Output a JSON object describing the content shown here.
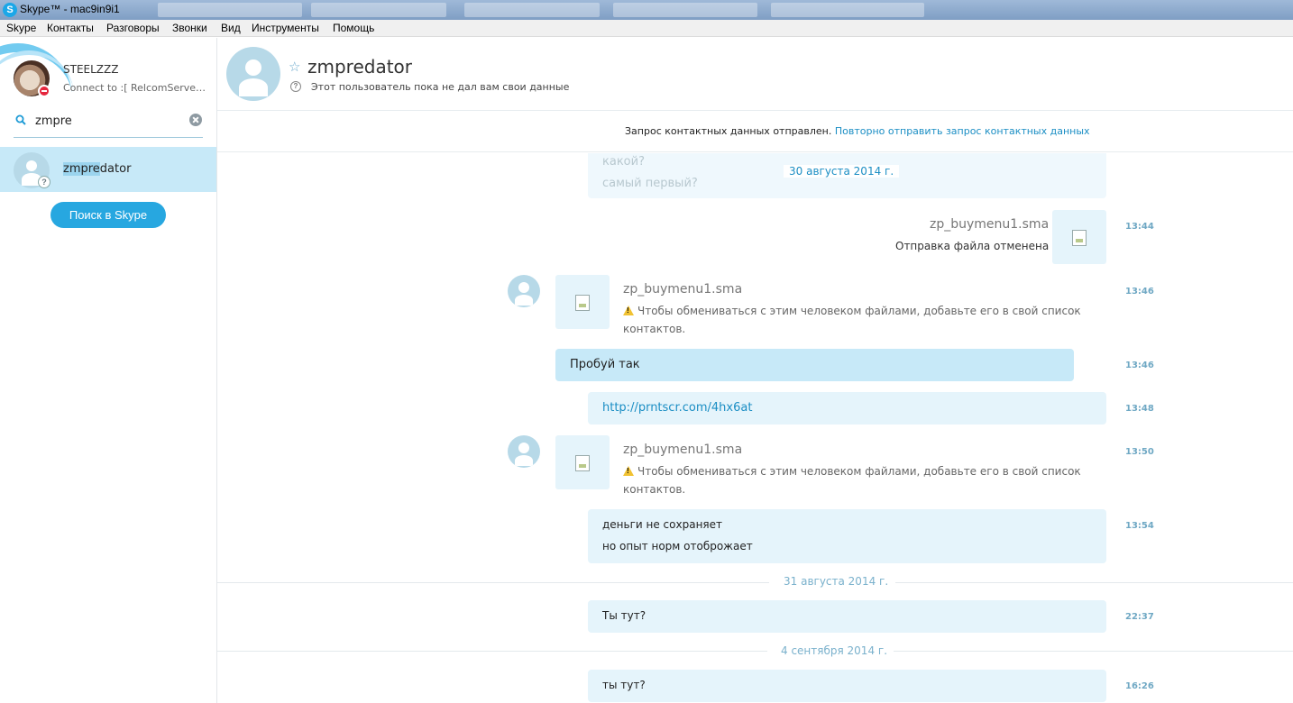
{
  "window": {
    "title": "Skype™ - mac9in9i1"
  },
  "menu": [
    "Skype",
    "Контакты",
    "Разговоры",
    "Звонки",
    "Вид",
    "Инструменты",
    "Помощь"
  ],
  "profile": {
    "name": "STEELZZZ",
    "status": "Connect to :[ RelcomServers.com ]"
  },
  "search": {
    "value": "zmpre",
    "results": [
      {
        "name": "zmpredator",
        "match_prefix": "zmpre",
        "match_rest": "dator"
      }
    ],
    "button": "Поиск в Skype"
  },
  "contact": {
    "name": "zmpredator",
    "subtitle": "Этот пользователь пока не дал вам свои данные"
  },
  "request": {
    "text": "Запрос контактных данных отправлен.",
    "link": "Повторно отправить запрос контактных данных"
  },
  "messages": {
    "faded_1": "какой?",
    "faded_2": "самый первый?",
    "date_1": "30 августа 2014 г.",
    "m1": {
      "file": "zp_buymenu1.sma",
      "status": "Отправка файла отменена",
      "time": "13:44"
    },
    "m2": {
      "file": "zp_buymenu1.sma",
      "note": "Чтобы обмениваться с этим человеком файлами, добавьте его в свой список контактов.",
      "time": "13:46"
    },
    "m3": {
      "text": "Пробуй так",
      "time": "13:46"
    },
    "m4": {
      "text": "http://prntscr.com/4hx6at",
      "time": "13:48"
    },
    "m5": {
      "file": "zp_buymenu1.sma",
      "note": "Чтобы обмениваться с этим человеком файлами, добавьте его в свой список контактов.",
      "time": "13:50"
    },
    "m6": {
      "line1": "деньги не сохраняет",
      "line2": "но опыт норм отоброжает",
      "time": "13:54"
    },
    "date_2": "31 августа 2014 г.",
    "m7": {
      "text": "Ты тут?",
      "time": "22:37"
    },
    "date_3": "4 сентября 2014 г.",
    "m8": {
      "text": "ты тут?",
      "time": "16:26"
    }
  },
  "colors": {
    "accent": "#27a7e0",
    "bubble": "#e5f4fb",
    "bubble_selected": "#c7e9f8",
    "link": "#1b8ec4"
  }
}
